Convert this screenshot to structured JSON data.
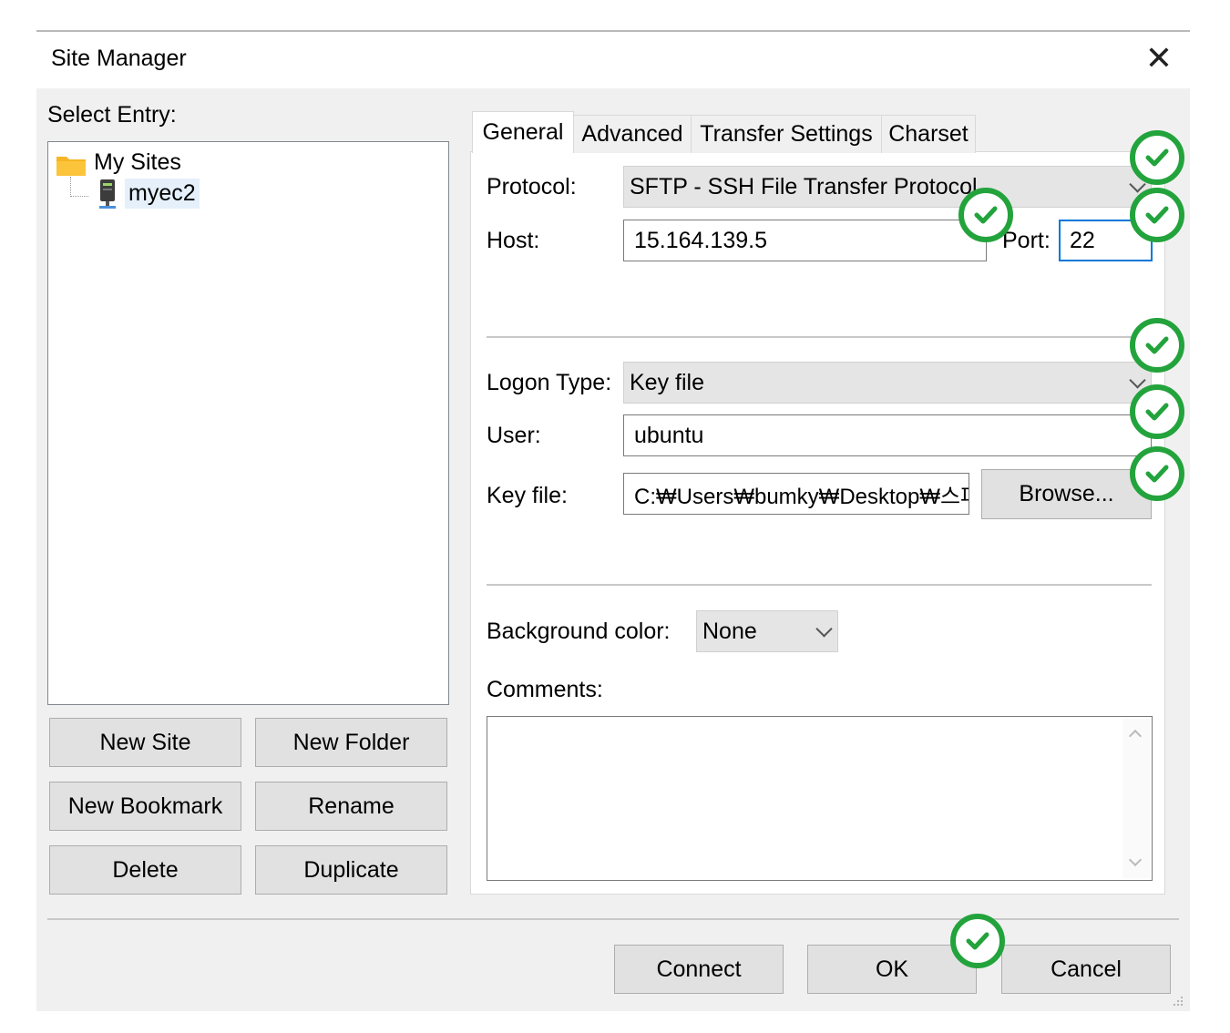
{
  "window": {
    "title": "Site Manager",
    "close_icon": "close-icon"
  },
  "left": {
    "select_entry_label": "Select Entry:",
    "tree": {
      "root": "My Sites",
      "child": "myec2"
    },
    "buttons": {
      "new_site": "New Site",
      "new_folder": "New Folder",
      "new_bookmark": "New Bookmark",
      "rename": "Rename",
      "delete": "Delete",
      "duplicate": "Duplicate"
    }
  },
  "tabs": [
    "General",
    "Advanced",
    "Transfer Settings",
    "Charset"
  ],
  "general": {
    "protocol_label": "Protocol:",
    "protocol_value": "SFTP - SSH File Transfer Protocol",
    "host_label": "Host:",
    "host_value": "15.164.139.5",
    "port_label": "Port:",
    "port_value": "22",
    "logon_type_label": "Logon Type:",
    "logon_type_value": "Key file",
    "user_label": "User:",
    "user_value": "ubuntu",
    "key_file_label": "Key file:",
    "key_file_value": "C:₩Users₩bumky₩Desktop₩스파",
    "browse_label": "Browse...",
    "background_color_label": "Background color:",
    "background_color_value": "None",
    "comments_label": "Comments:"
  },
  "footer": {
    "connect": "Connect",
    "ok": "OK",
    "cancel": "Cancel"
  },
  "colors": {
    "check_green": "#23a33c",
    "dialog_bg": "#f0f0f0",
    "focus_border": "#0078d7"
  }
}
